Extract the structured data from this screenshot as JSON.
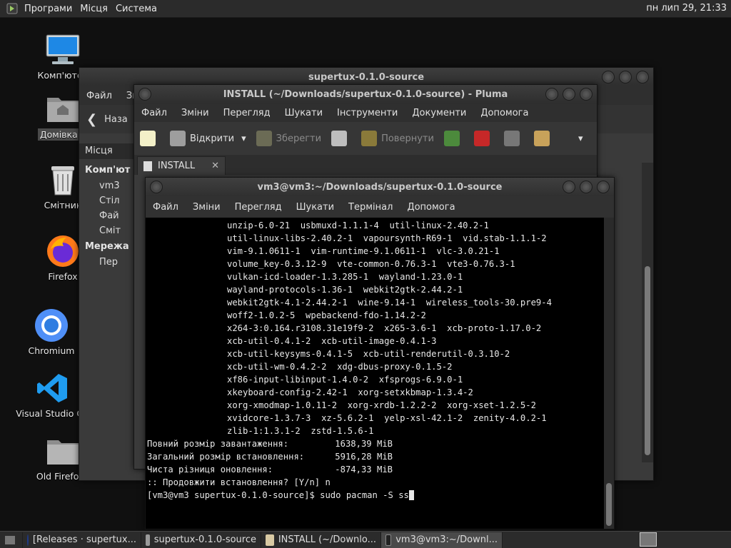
{
  "top_panel": {
    "menus": [
      "Програми",
      "Місця",
      "Система"
    ],
    "clock": "пн лип 29, 21:33"
  },
  "desktop_icons": [
    {
      "label": "Комп'ютер",
      "icon": "computer-icon"
    },
    {
      "label": "Домівка v",
      "icon": "home-folder-icon"
    },
    {
      "label": "Смітник",
      "icon": "trash-icon"
    },
    {
      "label": "Firefox",
      "icon": "firefox-icon"
    },
    {
      "label": "Chromium",
      "icon": "chromium-icon"
    },
    {
      "label": "Visual Studio Co",
      "icon": "vscode-icon"
    },
    {
      "label": "Old Firefox I",
      "icon": "folder-icon"
    }
  ],
  "caja": {
    "title": "supertux-0.1.0-source",
    "menu": [
      "Файл",
      "Зм"
    ],
    "back_label": "Наза",
    "places_label": "Місця",
    "sections": [
      {
        "header": "Комп'ют",
        "items": [
          "vm3",
          "Стіл",
          "Фай",
          "Сміт"
        ]
      },
      {
        "header": "Мережа",
        "items": [
          "Пер"
        ]
      }
    ]
  },
  "pluma": {
    "title": "INSTALL (~/Downloads/supertux-0.1.0-source) - Pluma",
    "menu": [
      "Файл",
      "Зміни",
      "Перегляд",
      "Шукати",
      "Інструменти",
      "Документи",
      "Допомога"
    ],
    "toolbar": {
      "open": "Відкрити",
      "save": "Зберегти",
      "revert": "Повернути"
    },
    "tab": "INSTALL"
  },
  "terminal": {
    "title": "vm3@vm3:~/Downloads/supertux-0.1.0-source",
    "menu": [
      "Файл",
      "Зміни",
      "Перегляд",
      "Шукати",
      "Термінал",
      "Допомога"
    ],
    "package_lines": [
      "unzip-6.0-21  usbmuxd-1.1.1-4  util-linux-2.40.2-1",
      "util-linux-libs-2.40.2-1  vapoursynth-R69-1  vid.stab-1.1.1-2",
      "vim-9.1.0611-1  vim-runtime-9.1.0611-1  vlc-3.0.21-1",
      "volume_key-0.3.12-9  vte-common-0.76.3-1  vte3-0.76.3-1",
      "vulkan-icd-loader-1.3.285-1  wayland-1.23.0-1",
      "wayland-protocols-1.36-1  webkit2gtk-2.44.2-1",
      "webkit2gtk-4.1-2.44.2-1  wine-9.14-1  wireless_tools-30.pre9-4",
      "woff2-1.0.2-5  wpebackend-fdo-1.14.2-2",
      "x264-3:0.164.r3108.31e19f9-2  x265-3.6-1  xcb-proto-1.17.0-2",
      "xcb-util-0.4.1-2  xcb-util-image-0.4.1-3",
      "xcb-util-keysyms-0.4.1-5  xcb-util-renderutil-0.3.10-2",
      "xcb-util-wm-0.4.2-2  xdg-dbus-proxy-0.1.5-2",
      "xf86-input-libinput-1.4.0-2  xfsprogs-6.9.0-1",
      "xkeyboard-config-2.42-1  xorg-setxkbmap-1.3.4-2",
      "xorg-xmodmap-1.0.11-2  xorg-xrdb-1.2.2-2  xorg-xset-1.2.5-2",
      "xvidcore-1.3.7-3  xz-5.6.2-1  yelp-xsl-42.1-2  zenity-4.0.2-1",
      "zlib-1:1.3.1-2  zstd-1.5.6-1"
    ],
    "summary": [
      {
        "label": "Повний розмір завантаження:",
        "value": "1638,39 MiB"
      },
      {
        "label": "Загальний розмір встановлення:",
        "value": "5916,28 MiB"
      },
      {
        "label": "Чиста різниця оновлення:",
        "value": "-874,33 MiB"
      }
    ],
    "prompt_question": ":: Продовжити встановлення? [Y/n] n",
    "prompt_line": "[vm3@vm3 supertux-0.1.0-source]$ sudo pacman -S ss"
  },
  "taskbar": {
    "tasks": [
      {
        "label": "[Releases · supertux...",
        "icon": "firefox-icon"
      },
      {
        "label": "supertux-0.1.0-source",
        "icon": "folder-icon"
      },
      {
        "label": "INSTALL (~/Downlo...",
        "icon": "text-editor-icon"
      },
      {
        "label": "vm3@vm3:~/Downl...",
        "icon": "terminal-icon",
        "active": true
      }
    ]
  }
}
